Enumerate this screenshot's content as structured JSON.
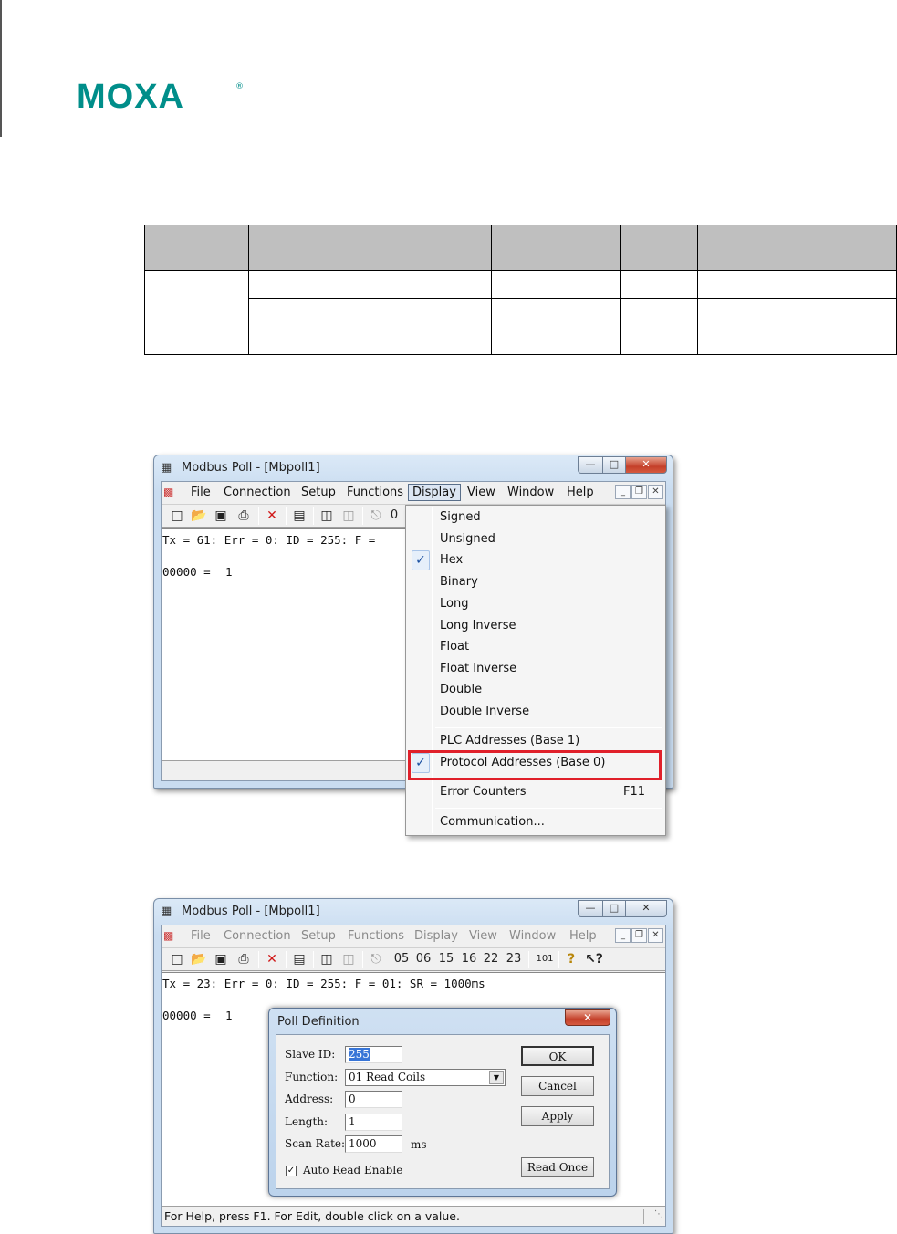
{
  "logo": {
    "text": "MOXA",
    "reg": "®"
  },
  "window1": {
    "title": "Modbus Poll - [Mbpoll1]",
    "menu": [
      "File",
      "Connection",
      "Setup",
      "Functions",
      "Display",
      "View",
      "Window",
      "Help"
    ],
    "open_menu": "Display",
    "status_line": "Tx = 61: Err = 0: ID = 255: F =",
    "status_line_tail": "0",
    "data_line": "00000 =",
    "data_value": "1"
  },
  "display_menu": {
    "items": [
      {
        "label": "Signed",
        "checked": false
      },
      {
        "label": "Unsigned",
        "checked": false
      },
      {
        "label": "Hex",
        "checked": true
      },
      {
        "label": "Binary",
        "checked": false
      },
      {
        "label": "Long",
        "checked": false
      },
      {
        "label": "Long Inverse",
        "checked": false
      },
      {
        "label": "Float",
        "checked": false
      },
      {
        "label": "Float Inverse",
        "checked": false
      },
      {
        "label": "Double",
        "checked": false
      },
      {
        "label": "Double Inverse",
        "checked": false
      },
      {
        "label": "PLC Addresses (Base 1)",
        "checked": false
      },
      {
        "label": "Protocol Addresses (Base 0)",
        "checked": true
      },
      {
        "label": "Error Counters",
        "accel": "F11",
        "checked": false
      },
      {
        "label": "Communication...",
        "checked": false
      }
    ],
    "highlight_color": "#e0202a"
  },
  "window2": {
    "title": "Modbus Poll - [Mbpoll1]",
    "menu": [
      "File",
      "Connection",
      "Setup",
      "Functions",
      "Display",
      "View",
      "Window",
      "Help"
    ],
    "toolbar_codes": [
      "05",
      "06",
      "15",
      "16",
      "22",
      "23",
      "101"
    ],
    "status_line": "Tx = 23: Err = 0: ID = 255: F = 01: SR = 1000ms",
    "data_line": "00000 =",
    "data_value": "1",
    "statusbar": "For Help, press F1.  For Edit, double click on a value."
  },
  "poll_definition": {
    "title": "Poll Definition",
    "slave_id_label": "Slave ID:",
    "slave_id": "255",
    "function_label": "Function:",
    "function": "01 Read Coils",
    "address_label": "Address:",
    "address": "0",
    "length_label": "Length:",
    "length": "1",
    "scan_rate_label": "Scan Rate:",
    "scan_rate": "1000",
    "scan_rate_unit": "ms",
    "auto_read_label": "Auto Read Enable",
    "auto_read_checked": true,
    "ok": "OK",
    "cancel": "Cancel",
    "apply": "Apply",
    "read_once": "Read Once"
  }
}
